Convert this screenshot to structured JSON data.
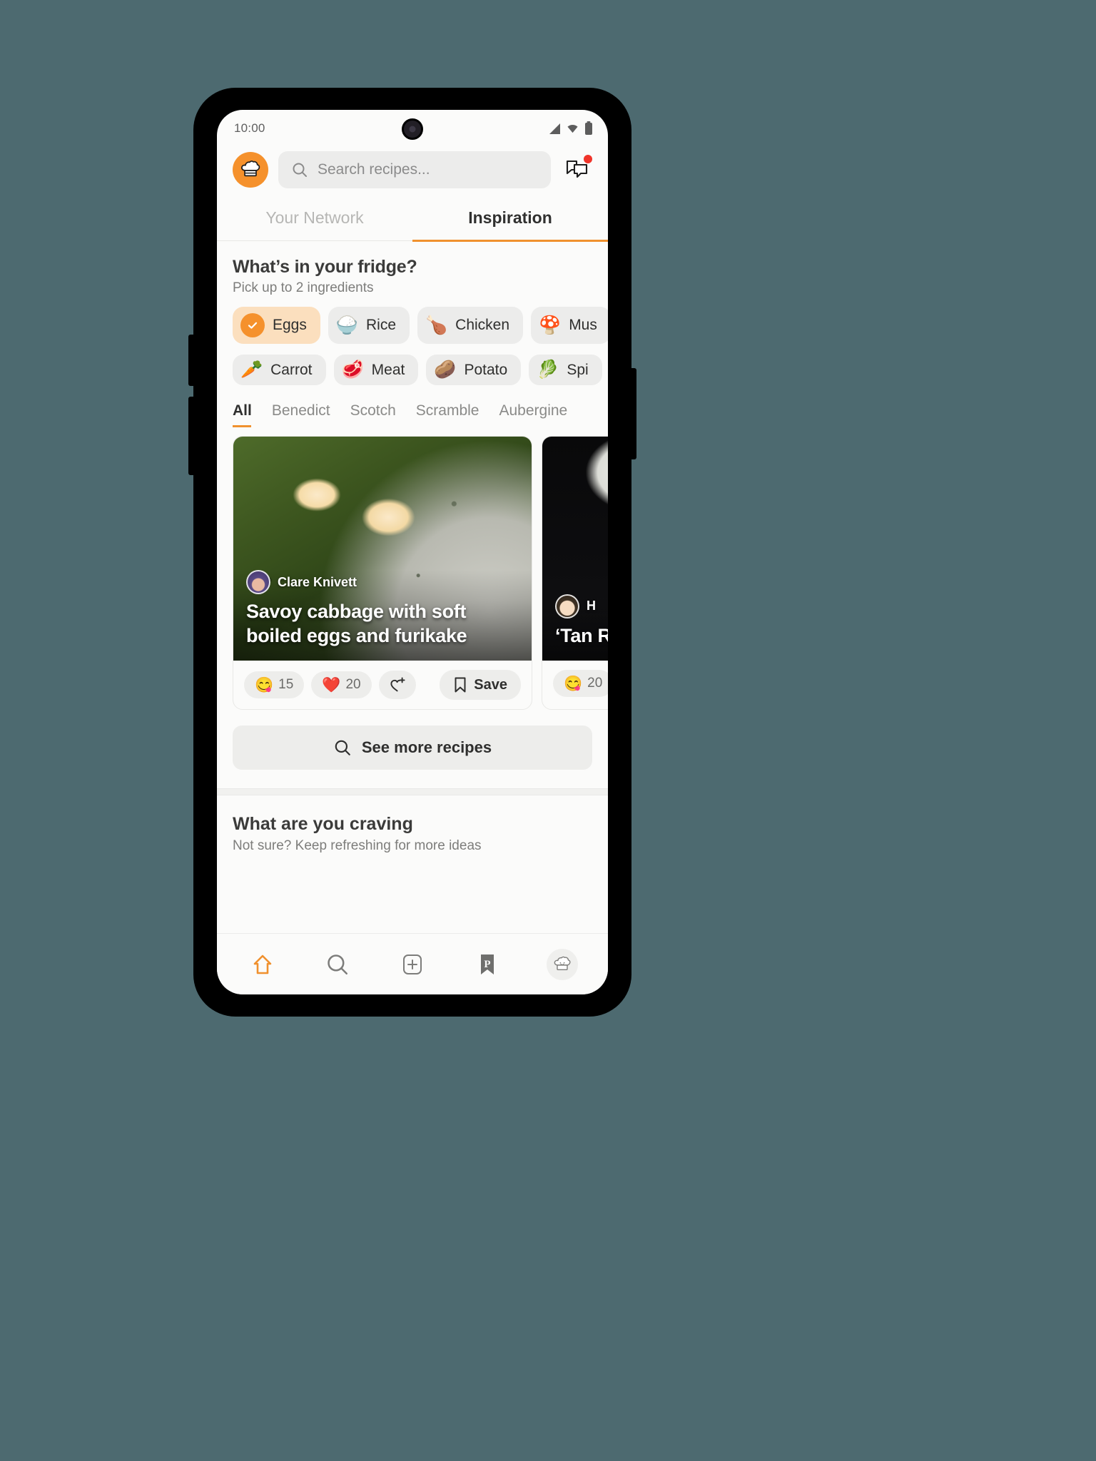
{
  "status_bar": {
    "time": "10:00",
    "icons": [
      "signal-icon",
      "wifi-icon",
      "battery-icon"
    ]
  },
  "header": {
    "logo_icon": "chef-hat-logo",
    "search": {
      "icon": "search-icon",
      "placeholder": "Search recipes...",
      "value": ""
    },
    "messages_icon": "chat-bubbles-icon",
    "messages_badge": true
  },
  "main_tabs": [
    {
      "label": "Your Network",
      "active": false
    },
    {
      "label": "Inspiration",
      "active": true
    }
  ],
  "fridge": {
    "title": "What’s in your fridge?",
    "subtitle": "Pick up to 2 ingredients",
    "chips": [
      {
        "label": "Eggs",
        "emoji": "✓",
        "selected": true
      },
      {
        "label": "Rice",
        "emoji": "🍚",
        "selected": false
      },
      {
        "label": "Chicken",
        "emoji": "🍗",
        "selected": false
      },
      {
        "label": "Mus",
        "emoji": "🍄",
        "selected": false
      },
      {
        "label": "Carrot",
        "emoji": "🥕",
        "selected": false
      },
      {
        "label": "Meat",
        "emoji": "🥩",
        "selected": false
      },
      {
        "label": "Potato",
        "emoji": "🥔",
        "selected": false
      },
      {
        "label": "Spi",
        "emoji": "🥬",
        "selected": false
      }
    ]
  },
  "filters": [
    {
      "label": "All",
      "active": true
    },
    {
      "label": "Benedict",
      "active": false
    },
    {
      "label": "Scotch",
      "active": false
    },
    {
      "label": "Scramble",
      "active": false
    },
    {
      "label": "Aubergine",
      "active": false
    }
  ],
  "recipe_cards": [
    {
      "author": "Clare Knivett",
      "title": "Savoy cabbage with soft boiled eggs and furikake",
      "reactions": [
        {
          "emoji": "😋",
          "count": "15"
        },
        {
          "emoji": "❤️",
          "count": "20"
        }
      ],
      "add_reaction_icon": "heart-plus-icon",
      "save_label": "Save",
      "save_icon": "bookmark-icon"
    },
    {
      "author": "H",
      "title": "‘Tan Rice",
      "reactions": [
        {
          "emoji": "😋",
          "count": "20"
        }
      ]
    }
  ],
  "see_more": {
    "label": "See more recipes",
    "icon": "search-icon"
  },
  "craving": {
    "title": "What are you craving",
    "subtitle": "Not sure? Keep refreshing for more ideas"
  },
  "bottom_nav": [
    {
      "name": "home",
      "icon": "home-icon",
      "active": true
    },
    {
      "name": "search",
      "icon": "search-icon",
      "active": false
    },
    {
      "name": "create",
      "icon": "plus-square-icon",
      "active": false
    },
    {
      "name": "saved",
      "icon": "bookmark-p-icon",
      "active": false
    },
    {
      "name": "profile",
      "icon": "chef-hat-icon",
      "active": false
    }
  ],
  "colors": {
    "accent": "#f0912e",
    "logo_bg": "#f5912c",
    "chip_selected_bg": "#fbdfbe",
    "badge": "#f0342a",
    "page_bg": "#4d6a70"
  }
}
